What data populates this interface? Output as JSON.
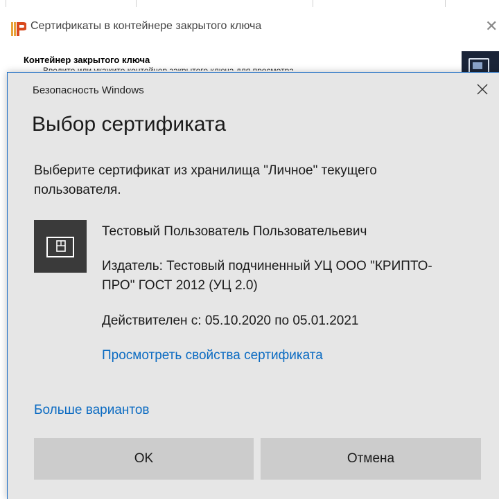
{
  "background_window": {
    "title": "Сертификаты в контейнере закрытого ключа",
    "heading": "Контейнер закрытого ключа",
    "subtext": "Введите или укажите контейнер закрытого ключа для просмотра"
  },
  "dialog": {
    "caption": "Безопасность Windows",
    "title": "Выбор сертификата",
    "description": "Выберите сертификат из хранилища \"Личное\" текущего пользователя.",
    "certificate": {
      "icon": "certificate-icon",
      "name": "Тестовый Пользователь Пользовательевич",
      "issuer": "Издатель: Тестовый подчиненный УЦ ООО \"КРИПТО-ПРО\" ГОСТ 2012 (УЦ 2.0)",
      "validity": "Действителен с: 05.10.2020 по 05.01.2021",
      "view_properties_link": "Просмотреть свойства сертификата"
    },
    "more_options_link": "Больше вариантов",
    "ok_label": "OK",
    "cancel_label": "Отмена"
  },
  "colors": {
    "dialog_bg": "#e6e6e6",
    "link": "#0b6bc2",
    "button_bg": "#cccccc",
    "accent_border": "#1f6fc5",
    "cert_icon_bg": "#3a3a3a"
  }
}
